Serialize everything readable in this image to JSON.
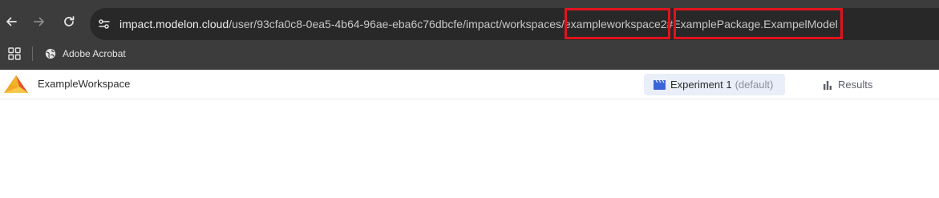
{
  "browser": {
    "url": {
      "host": "impact.modelon.cloud",
      "path_start": "/user/93cfa0c8-0ea5-4b64-96ae-eba6c76dbcfe/impact/workspaces/",
      "workspace": "exampleworkspace2",
      "hash": "#",
      "model": "ExamplePackage.ExampelModel"
    },
    "bookmarks": [
      {
        "label": "Adobe Acrobat",
        "icon": "globe-icon"
      }
    ],
    "highlight_color": "#e0141e"
  },
  "app": {
    "workspace_name": "ExampleWorkspace",
    "tabs": {
      "experiment": {
        "label": "Experiment 1",
        "suffix": "(default)",
        "icon": "clapperboard-icon"
      },
      "results": {
        "label": "Results",
        "icon": "bar-chart-icon"
      }
    },
    "accent_color": "#3b63d9"
  }
}
